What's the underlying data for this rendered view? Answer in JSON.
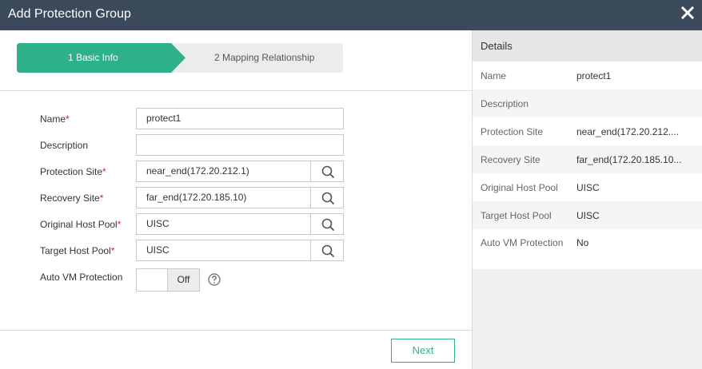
{
  "dialog": {
    "title": "Add Protection Group"
  },
  "steps": [
    {
      "label": "1 Basic Info",
      "active": true
    },
    {
      "label": "2 Mapping Relationship",
      "active": false
    }
  ],
  "form": {
    "name": {
      "label": "Name",
      "value": "protect1",
      "required": "*"
    },
    "description": {
      "label": "Description",
      "value": ""
    },
    "protection_site": {
      "label": "Protection Site",
      "value": "near_end(172.20.212.1)",
      "required": "*"
    },
    "recovery_site": {
      "label": "Recovery Site",
      "value": "far_end(172.20.185.10)",
      "required": "*"
    },
    "original_host_pool": {
      "label": "Original Host Pool",
      "value": "UISC",
      "required": "*"
    },
    "target_host_pool": {
      "label": "Target Host Pool",
      "value": "UISC",
      "required": "*"
    },
    "auto_vm_protection": {
      "label": "Auto VM Protection",
      "state": "Off"
    }
  },
  "footer": {
    "next_label": "Next"
  },
  "details": {
    "title": "Details",
    "rows": [
      {
        "key": "Name",
        "value": "protect1"
      },
      {
        "key": "Description",
        "value": ""
      },
      {
        "key": "Protection Site",
        "value": "near_end(172.20.212...."
      },
      {
        "key": "Recovery Site",
        "value": "far_end(172.20.185.10..."
      },
      {
        "key": "Original Host Pool",
        "value": "UISC"
      },
      {
        "key": "Target Host Pool",
        "value": "UISC"
      },
      {
        "key": "Auto VM Protection",
        "value": "No"
      }
    ]
  },
  "colors": {
    "accent": "#2eb08a",
    "titlebar": "#3a4a5a",
    "required": "#e02020"
  },
  "icons": [
    "close-icon",
    "search-icon",
    "help-icon"
  ]
}
